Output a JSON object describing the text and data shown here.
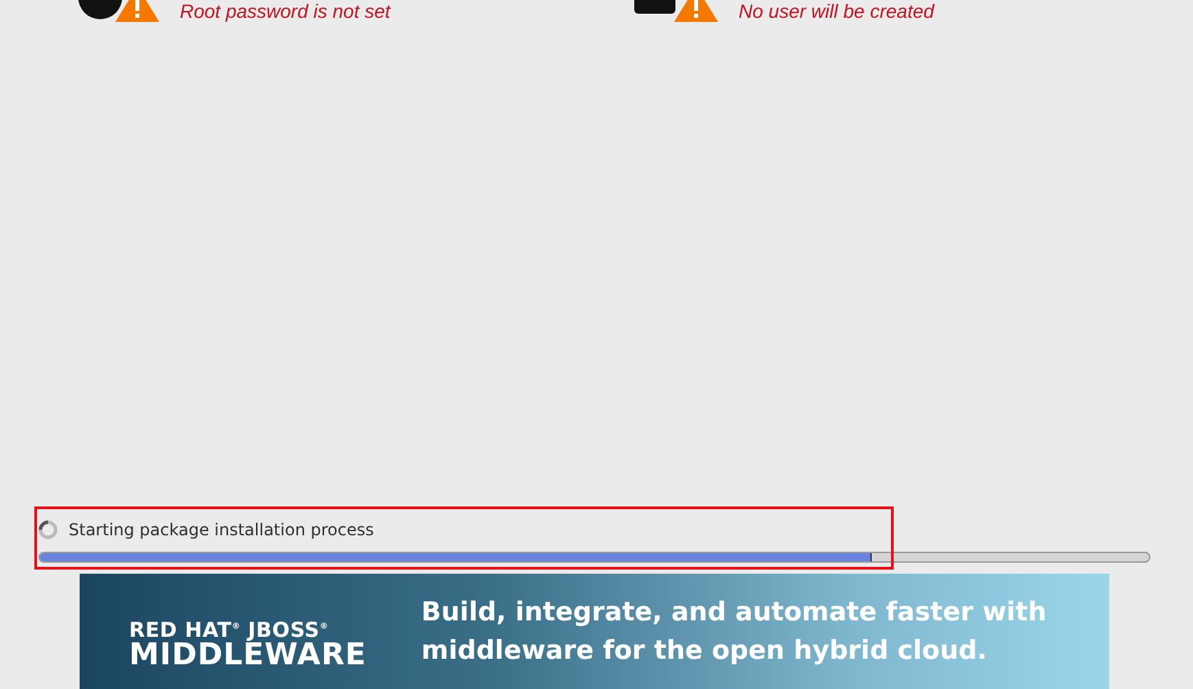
{
  "spokes": [
    {
      "kind": "root",
      "message": "Root password is not set"
    },
    {
      "kind": "user",
      "message": "No user will be created"
    }
  ],
  "progress": {
    "status": "Starting package installation process",
    "level": 0.75,
    "highlighted": true
  },
  "banner": {
    "brand_line": "RED HAT$^{®}$ JBOSS$^{®}$",
    "product": "MIDDLEWARE",
    "tagline": "Build, integrate, and automate faster with middleware for the open hybrid cloud."
  }
}
